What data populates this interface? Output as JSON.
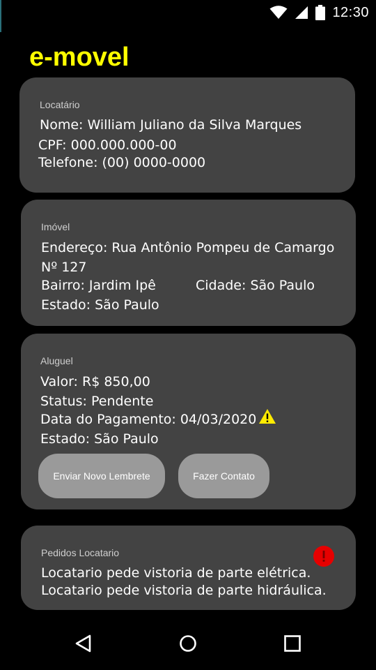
{
  "status_bar": {
    "time": "12:30",
    "icons": [
      "wifi-icon",
      "signal-icon",
      "battery-icon"
    ]
  },
  "app": {
    "title": "e-movel",
    "title_color": "#ffff00"
  },
  "tenant": {
    "header": "Locatário",
    "name_line": "Nome: William Juliano da Silva Marques",
    "cpf_line": "CPF: 000.000.000-00",
    "phone_line": "Telefone: (00) 0000-0000"
  },
  "property": {
    "header": "Imóvel",
    "address_line": "Endereço: Rua Antônio Pompeu de Camargo",
    "number_line": "Nº 127",
    "neighborhood_line": "Bairro: Jardim Ipê",
    "city_line": "Cidade: São Paulo",
    "state_line": "Estado: São Paulo"
  },
  "rent": {
    "header": "Aluguel",
    "value_line": "Valor: R$ 850,00",
    "status_line": "Status: Pendente",
    "payment_date_line": "Data do Pagamento: 04/03/2020",
    "state_line": "Estado: São Paulo",
    "warning_icon": "warning-icon",
    "warning_color": "#ffeb00",
    "buttons": {
      "reminder": "Enviar Novo Lembrete",
      "contact": "Fazer Contato"
    }
  },
  "requests": {
    "header": "Pedidos Locatario",
    "alert_icon": "alert-icon",
    "alert_color": "#e60000",
    "items": [
      "Locatario pede vistoria de parte elétrica.",
      "Locatario pede vistoria de parte hidráulica."
    ]
  },
  "nav_bar": {
    "icons": [
      "back-icon",
      "home-icon",
      "recents-icon"
    ]
  }
}
